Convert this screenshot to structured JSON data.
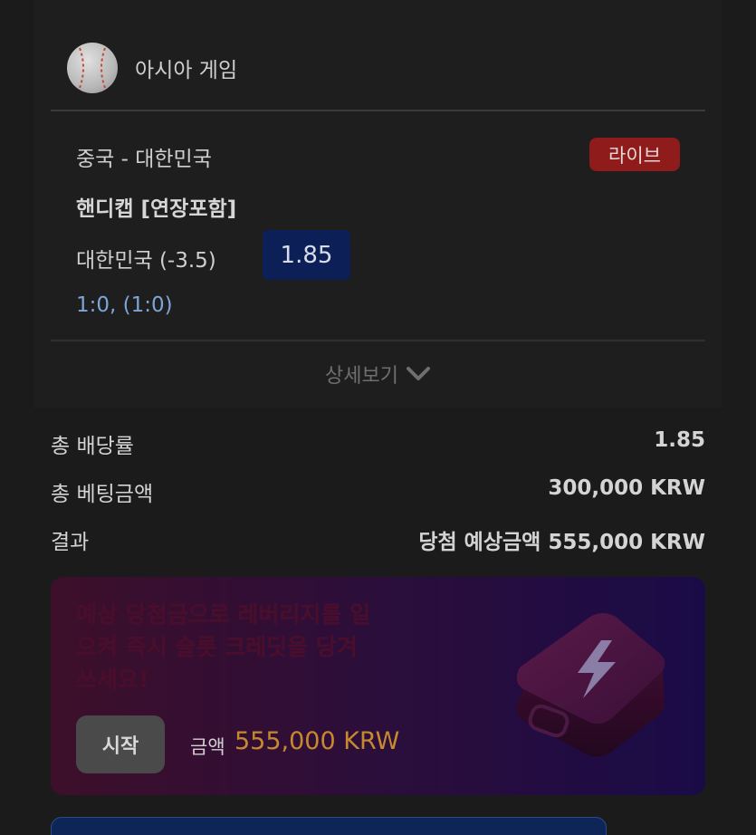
{
  "league": {
    "name": "아시아 게임",
    "sport_icon": "baseball-icon"
  },
  "match": {
    "title": "중국 - 대한민국",
    "live_badge": "라이브",
    "market": "핸디캡 [연장포함]",
    "selection": "대한민국 (-3.5)",
    "odds": "1.85",
    "score": "1:0, (1:0)"
  },
  "details_toggle": {
    "label": "상세보기",
    "icon": "chevron-down-icon"
  },
  "summary": {
    "total_odds_label": "총 배당률",
    "total_odds_value": "1.85",
    "total_stake_label": "총 베팅금액",
    "total_stake_value": "300,000 KRW",
    "result_label": "결과",
    "result_value": "당첨 예상금액 555,000 KRW"
  },
  "promo": {
    "text": "예상 당첨금으로 레버리지를 일으켜 즉시 슬롯 크레딧을 당겨 쓰세요!",
    "start_label": "시작",
    "amount_label": "금액",
    "amount_value": "555,000 KRW",
    "illustration": "lightning-cube-icon"
  },
  "colors": {
    "background": "#1b1b1b",
    "live_badge": "#8f1b1b",
    "odds_box": "#0d1f57",
    "score_text": "#7da6d6",
    "amount_text": "#c7892e"
  }
}
